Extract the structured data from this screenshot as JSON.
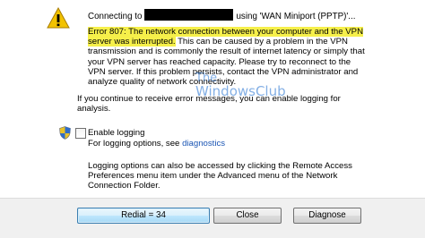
{
  "dialog": {
    "connecting_prefix": "Connecting to",
    "connecting_suffix": "using 'WAN Miniport (PPTP)'...",
    "error_highlight": "Error 807: The network connection between your computer and the VPN server was interrupted.",
    "error_rest": " This can be caused by a problem in the VPN transmission and is commonly the result of internet latency or simply that your VPN server has reached capacity.  Please try to reconnect to the VPN server.  If this problem persists, contact the VPN administrator and analyze quality of network connectivity.",
    "logging_note": "If you continue to receive error messages, you can enable logging for analysis.",
    "enable_logging_label": "Enable logging",
    "logging_options_prefix": "For logging options, see",
    "diagnostics_link": "diagnostics",
    "logging_info": "Logging options can also be accessed by clicking the Remote Access Preferences menu item under the Advanced menu of the Network Connection Folder."
  },
  "watermark": {
    "line1": "The",
    "line2": "WindowsClub"
  },
  "buttons": {
    "redial": "Redial = 34",
    "close": "Close",
    "diagnose": "Diagnose"
  },
  "colors": {
    "highlight": "#f6f04a",
    "link": "#1a55b4",
    "warning": "#f2c200"
  }
}
